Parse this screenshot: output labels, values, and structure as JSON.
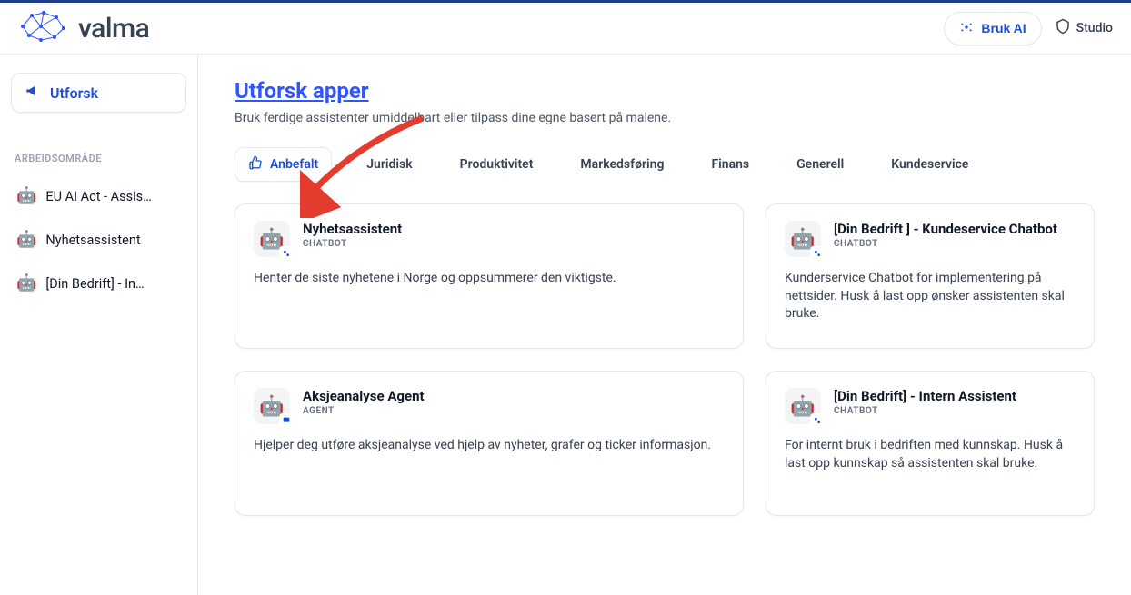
{
  "brand": {
    "name": "valma"
  },
  "header": {
    "bruk_ai": "Bruk AI",
    "studio": "Studio"
  },
  "sidebar": {
    "explore_label": "Utforsk",
    "section_label": "ARBEIDSOMRÅDE",
    "items": [
      {
        "label": "EU AI Act - Assis…"
      },
      {
        "label": "Nyhetsassistent"
      },
      {
        "label": "[Din Bedrift] - In…"
      }
    ]
  },
  "page": {
    "title": "Utforsk apper",
    "subtitle": "Bruk ferdige assistenter umiddelbart eller tilpass dine egne basert på malene."
  },
  "tabs": [
    {
      "key": "anbefalt",
      "label": "Anbefalt",
      "active": true
    },
    {
      "key": "juridisk",
      "label": "Juridisk"
    },
    {
      "key": "produktivitet",
      "label": "Produktivitet"
    },
    {
      "key": "markedsforing",
      "label": "Markedsføring"
    },
    {
      "key": "finans",
      "label": "Finans"
    },
    {
      "key": "generell",
      "label": "Generell"
    },
    {
      "key": "kundeservice",
      "label": "Kundeservice"
    }
  ],
  "cards": [
    {
      "title": "Nyhetsassistent",
      "tag": "CHATBOT",
      "desc": "Henter de siste nyhetene i Norge og oppsummerer den viktigste."
    },
    {
      "title": "[Din Bedrift ] - Kundeservice Chatbot",
      "tag": "CHATBOT",
      "desc": "Kunderservice Chatbot for implementering på nettsider. Husk å last opp ønsker assistenten skal bruke."
    },
    {
      "title": "Aksjeanalyse Agent",
      "tag": "AGENT",
      "desc": "Hjelper deg utføre aksjeanalyse ved hjelp av nyheter, grafer og ticker informasjon."
    },
    {
      "title": "[Din Bedrift] - Intern Assistent",
      "tag": "CHATBOT",
      "desc": "For internt bruk i bedriften med kunnskap. Husk å last opp kunnskap så assistenten skal bruke."
    }
  ]
}
